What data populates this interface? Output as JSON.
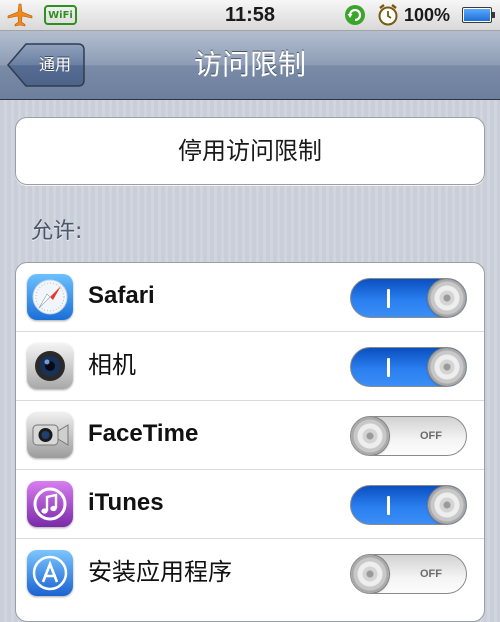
{
  "status_bar": {
    "airplane_icon": "airplane-icon",
    "wifi_badge": "WiFi",
    "time": "11:58",
    "sync_icon": "sync-icon",
    "alarm_icon": "alarm-icon",
    "battery_percent": "100%",
    "battery_level": 1.0
  },
  "nav": {
    "back_label": "通用",
    "title": "访问限制"
  },
  "disable_button_label": "停用访问限制",
  "section_header": "允许:",
  "apps": [
    {
      "label": "Safari",
      "icon": "safari-icon",
      "enabled": true
    },
    {
      "label": "相机",
      "icon": "camera-icon",
      "enabled": true
    },
    {
      "label": "FaceTime",
      "icon": "facetime-icon",
      "enabled": false
    },
    {
      "label": "iTunes",
      "icon": "itunes-icon",
      "enabled": true
    },
    {
      "label": "安装应用程序",
      "icon": "app-store-icon",
      "enabled": false
    }
  ],
  "switch_off_text": "OFF",
  "colors": {
    "switch_on": "#2a7ff0",
    "nav_bar": "#7a8ba7",
    "background": "#c9ced8"
  }
}
